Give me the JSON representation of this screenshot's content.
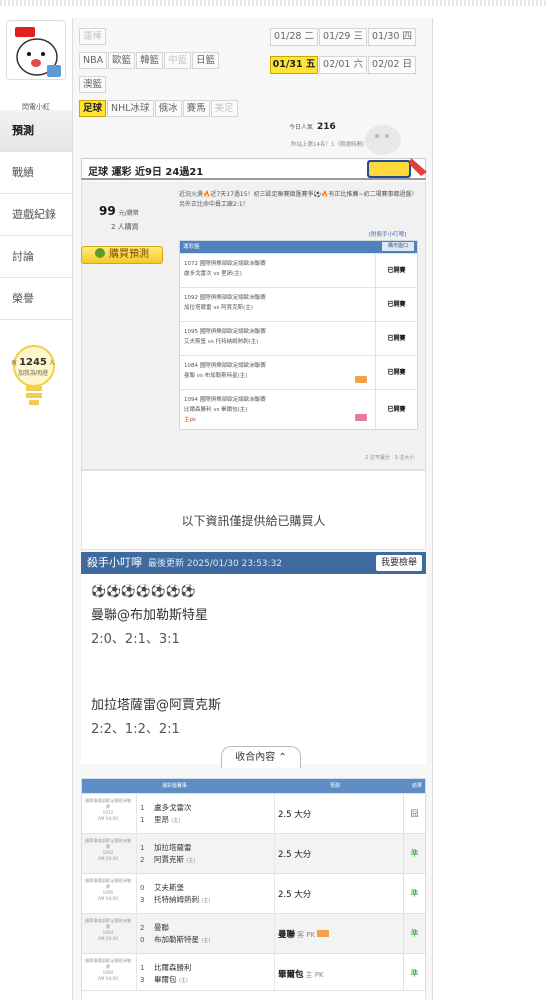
{
  "user": {
    "name": "閃電小紅",
    "popularity_value": "1245",
    "popularity_unit": "人",
    "popularity_caption": "加我為明燈"
  },
  "nav": [
    "預測",
    "戰績",
    "遊戲紀錄",
    "討論",
    "榮譽"
  ],
  "categories": [
    "運棒",
    "NBA",
    "歐籃",
    "韓籃",
    "中籃",
    "日籃",
    "澳籃",
    "足球",
    "NHL冰球",
    "俄冰",
    "賽馬",
    "美足"
  ],
  "dates": [
    "01/28 二",
    "01/29 三",
    "01/30 四",
    "01/31 五",
    "02/01 六",
    "02/02 日"
  ],
  "stats": {
    "popularity_label": "今日人氣",
    "popularity_value": "216",
    "rank_text": "昨站上第14名！1（限選時間）"
  },
  "section_title": "足球 運彩 近9日 24過21",
  "purchase": {
    "price": "99",
    "price_unit": "元/鑽幣",
    "buyers": "2 人購買",
    "button": "購買預測",
    "intro": "近況火燙🔥近7天17過15！初三歐足聯賽鎮匯賽爭⚽️🔥有正比推薦~初二場賽事都過盤！另外正比命中員工廠2:1！",
    "attach": "[附殺手小叮嚀]",
    "table_head": "運彩盤",
    "table_head_right": "購市盤口",
    "rows": [
      {
        "line1": "1072 國際俱樂部歐足總歐洲聯賽",
        "line2": "盧多戈雷次 vs 里昂(主)",
        "status": "已開賽",
        "extra": ""
      },
      {
        "line1": "1092 國際俱樂部歐足總歐洲聯賽",
        "line2": "加拉塔薩雷 vs 阿賈克斯(主)",
        "status": "已開賽",
        "extra": ""
      },
      {
        "line1": "1095 國際俱樂部歐足總歐洲聯賽",
        "line2": "艾夫斯堡 vs 托特納姆熱刺(主)",
        "status": "已開賽",
        "extra": ""
      },
      {
        "line1": "1084 國際俱樂部歐足總歐洲聯賽",
        "line2": "曼聯 vs 布加勒斯特星(主)",
        "status": "已開賽",
        "extra": ""
      },
      {
        "line1": "1094 國際俱樂部歐足總歐洲聯賽",
        "line2": "比爾森勝利 vs 畢爾包(主)",
        "status": "已開賽",
        "extra": "主pk"
      }
    ],
    "note": "2 注不讓分 · 3 注大小"
  },
  "info_message": "以下資訊僅提供給已購買人",
  "killer": {
    "title": "殺手小叮嚀",
    "updated": "最後更新 2025/01/30 23:53:32",
    "report": "我要檢舉",
    "balls": "⚽⚽⚽⚽⚽⚽⚽",
    "m1": "曼聯@布加勒斯特星",
    "s1": "2:0、2:1、3:1",
    "m2": "加拉塔薩雷@阿賈克斯",
    "s2": "2:2、1:2、2:1",
    "collapse": "收合內容 ⌃"
  },
  "results": {
    "head": [
      "運彩盤賽事",
      "預測",
      "結果"
    ],
    "rows": [
      {
        "league": "國際俱樂部歐足總歐洲聯賽",
        "code": "1072",
        "time": "AM 04:00",
        "s1": "1",
        "s2": "1",
        "t1": "盧多戈雷次",
        "t2": "里昂",
        "pred": "2.5 大分",
        "result": "囧"
      },
      {
        "league": "國際俱樂部歐足總歐洲聯賽",
        "code": "1092",
        "time": "AM 04:00",
        "s1": "1",
        "s2": "2",
        "t1": "加拉塔薩雷",
        "t2": "阿賈克斯",
        "pred": "2.5 大分",
        "result": "準"
      },
      {
        "league": "國際俱樂部歐足總歐洲聯賽",
        "code": "1095",
        "time": "AM 04:00",
        "s1": "0",
        "s2": "3",
        "t1": "艾夫斯堡",
        "t2": "托特納姆熱刺",
        "pred": "2.5 大分",
        "result": "準"
      },
      {
        "league": "國際俱樂部歐足總歐洲聯賽",
        "code": "1084",
        "time": "AM 04:00",
        "s1": "2",
        "s2": "0",
        "t1": "曼聯",
        "t2": "布加勒斯特星",
        "pred": "曼聯",
        "pred_side": "客 PK",
        "result": "準"
      },
      {
        "league": "國際俱樂部歐足總歐洲聯賽",
        "code": "1094",
        "time": "AM 04:00",
        "s1": "1",
        "s2": "3",
        "t1": "比爾森勝利",
        "t2": "畢爾包",
        "pred": "畢爾包",
        "pred_side": "主 PK",
        "result": "準"
      }
    ],
    "home_mark": "(主)"
  }
}
